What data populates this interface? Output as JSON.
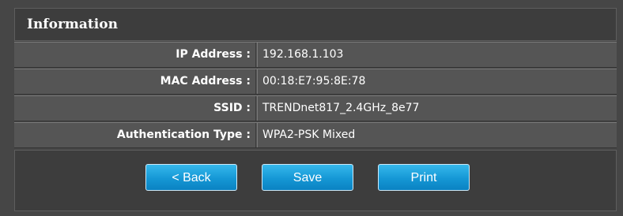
{
  "section": {
    "title": "Information"
  },
  "info_rows": [
    {
      "label": "IP Address :",
      "value": "192.168.1.103"
    },
    {
      "label": "MAC Address :",
      "value": "00:18:E7:95:8E:78"
    },
    {
      "label": "SSID :",
      "value": "TRENDnet817_2.4GHz_8e77"
    },
    {
      "label": "Authentication Type :",
      "value": "WPA2-PSK Mixed"
    }
  ],
  "buttons": {
    "back": "< Back",
    "save": "Save",
    "print": "Print"
  },
  "colors": {
    "button_blue": "#1597d5",
    "panel_bg": "#464646",
    "row_bg": "#555555"
  }
}
